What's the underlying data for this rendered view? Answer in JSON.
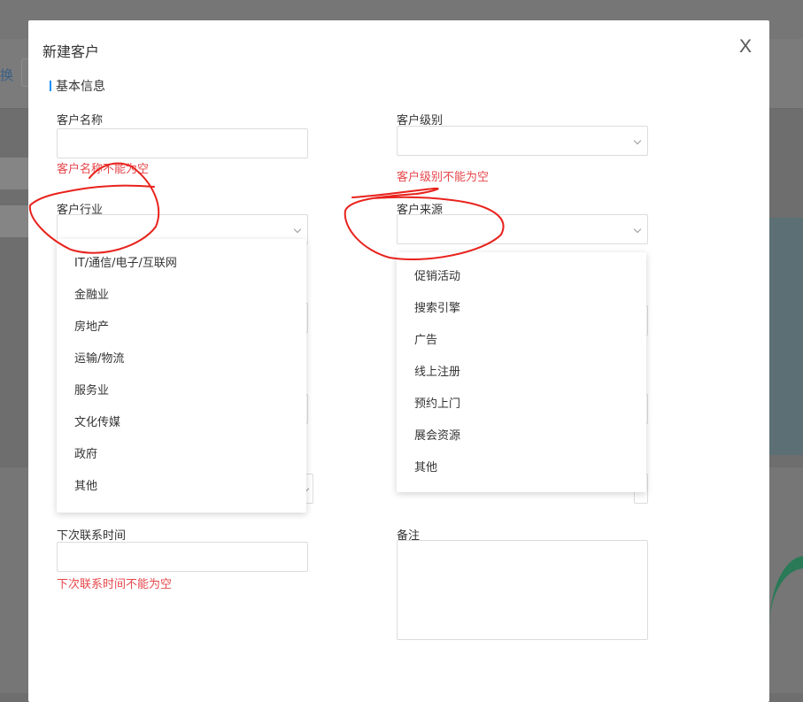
{
  "modal": {
    "title": "新建客户",
    "close_label": "X",
    "section_title": "基本信息"
  },
  "background": {
    "left_text": "换"
  },
  "fields": {
    "customer_name": {
      "label": "客户名称",
      "value": "",
      "error": "客户名称不能为空"
    },
    "customer_level": {
      "label": "客户级别",
      "value": "",
      "error": "客户级别不能为空"
    },
    "customer_industry": {
      "label": "客户行业",
      "value": ""
    },
    "customer_source": {
      "label": "客户来源",
      "value": ""
    },
    "next_contact_time": {
      "label": "下次联系时间",
      "value": "",
      "error": "下次联系时间不能为空"
    },
    "remarks": {
      "label": "备注",
      "value": ""
    }
  },
  "industry_options": [
    "IT/通信/电子/互联网",
    "金融业",
    "房地产",
    "运输/物流",
    "服务业",
    "文化传媒",
    "政府",
    "其他"
  ],
  "source_options": [
    "促销活动",
    "搜索引擎",
    "广告",
    "线上注册",
    "预约上门",
    "展会资源",
    "其他"
  ],
  "colors": {
    "error": "#e5474b",
    "accent": "#1890ff",
    "annotation": "#e8221c"
  }
}
